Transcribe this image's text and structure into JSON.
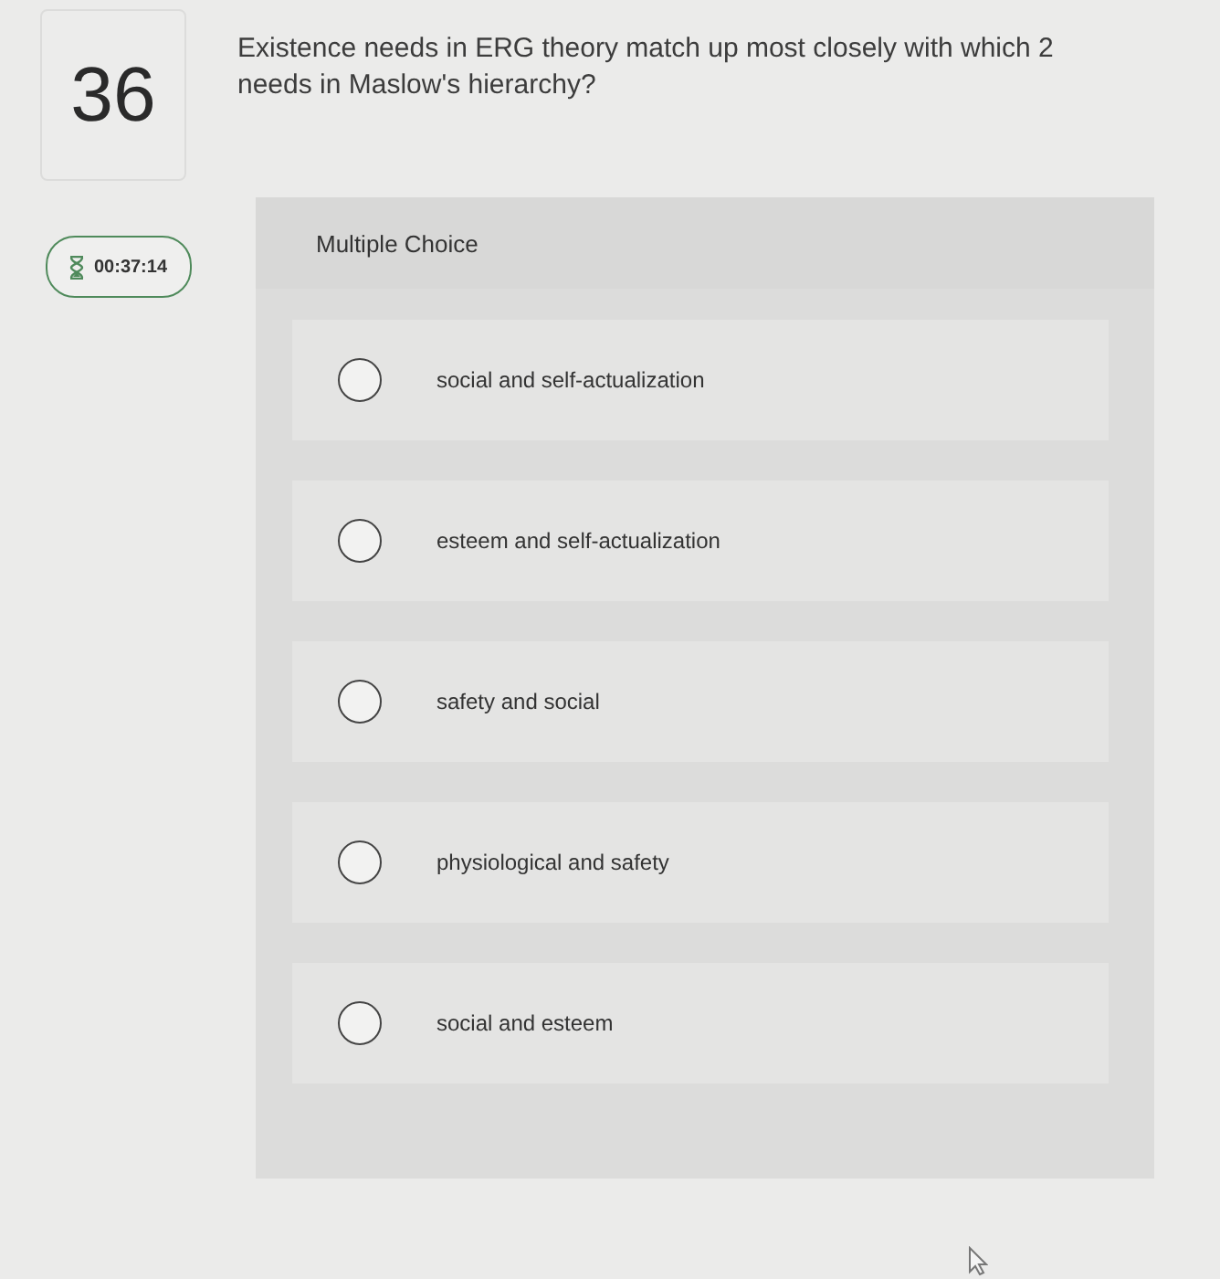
{
  "question": {
    "number": "36",
    "text": "Existence needs in ERG theory match up most closely with which 2 needs in Maslow's hierarchy?"
  },
  "timer": {
    "time": "00:37:14"
  },
  "answer_panel": {
    "type_label": "Multiple Choice",
    "options": [
      {
        "label": "social and self-actualization",
        "selected": false
      },
      {
        "label": "esteem and self-actualization",
        "selected": false
      },
      {
        "label": "safety and social",
        "selected": false
      },
      {
        "label": "physiological and safety",
        "selected": false
      },
      {
        "label": "social and esteem",
        "selected": false
      }
    ]
  }
}
